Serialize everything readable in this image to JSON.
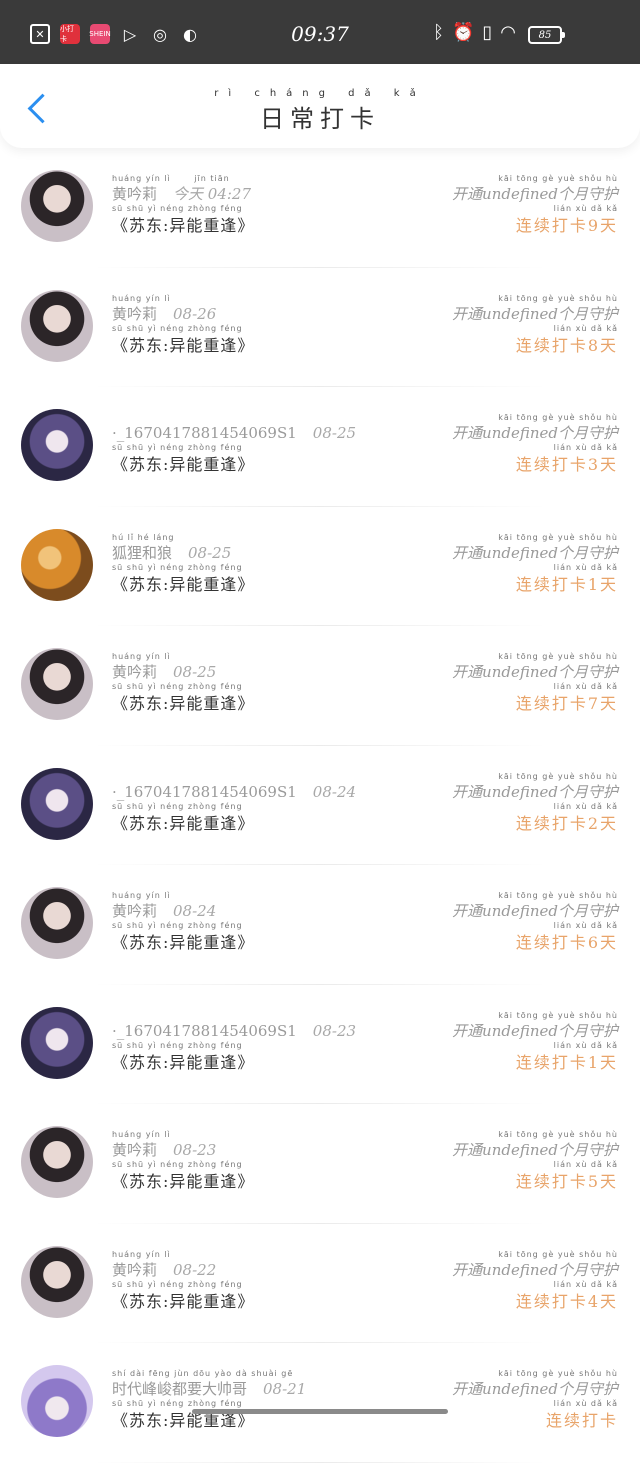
{
  "status_bar": {
    "time": "09:37",
    "battery": "85",
    "left_icons": [
      "x-box-icon",
      "app-red-icon",
      "app-pink-icon",
      "play-icon",
      "weibo-icon",
      "compass-icon"
    ],
    "right_icons": [
      "bluetooth-icon",
      "alarm-icon",
      "vibrate-icon",
      "wifi-icon",
      "battery-icon"
    ],
    "app_red_label": "小打卡",
    "app_pink_label": "SHEIN"
  },
  "header": {
    "title_pinyin": "rì cháng dǎ kǎ",
    "title": "日常打卡"
  },
  "colors": {
    "accent_blue": "#2b8ff0",
    "streak_orange": "#e8a46a"
  },
  "list": [
    {
      "name_pinyin": "huáng yín lì",
      "name": "黄吟莉",
      "date_pinyin": "jīn tiān",
      "date": "今天 04:27",
      "book_pinyin": "sū shū yì néng zhòng féng",
      "book": "《苏东:异能重逢》",
      "status_pinyin": "kāi tōng gè yuè shǒu hù",
      "status": "开通undefined个月守护",
      "streak_pinyin": "lián xù dǎ kǎ",
      "streak": "连续打卡9天",
      "avatar": "a"
    },
    {
      "name_pinyin": "huáng yín lì",
      "name": "黄吟莉",
      "date_pinyin": "",
      "date": "08-26",
      "book_pinyin": "sū shū yì néng zhòng féng",
      "book": "《苏东:异能重逢》",
      "status_pinyin": "kāi tōng gè yuè shǒu hù",
      "status": "开通undefined个月守护",
      "streak_pinyin": "lián xù dǎ kǎ",
      "streak": "连续打卡8天",
      "avatar": "a"
    },
    {
      "name_pinyin": "",
      "name": "·_1670417881454069S1",
      "date_pinyin": "",
      "date": "08-25",
      "book_pinyin": "sū shū yì néng zhòng féng",
      "book": "《苏东:异能重逢》",
      "status_pinyin": "kāi tōng gè yuè shǒu hù",
      "status": "开通undefined个月守护",
      "streak_pinyin": "lián xù dǎ kǎ",
      "streak": "连续打卡3天",
      "avatar": "b"
    },
    {
      "name_pinyin": "hú lǐ hé láng",
      "name": "狐狸和狼",
      "date_pinyin": "",
      "date": "08-25",
      "book_pinyin": "sū shū yì néng zhòng féng",
      "book": "《苏东:异能重逢》",
      "status_pinyin": "kāi tōng gè yuè shǒu hù",
      "status": "开通undefined个月守护",
      "streak_pinyin": "lián xù dǎ kǎ",
      "streak": "连续打卡1天",
      "avatar": "c"
    },
    {
      "name_pinyin": "huáng yín lì",
      "name": "黄吟莉",
      "date_pinyin": "",
      "date": "08-25",
      "book_pinyin": "sū shū yì néng zhòng féng",
      "book": "《苏东:异能重逢》",
      "status_pinyin": "kāi tōng gè yuè shǒu hù",
      "status": "开通undefined个月守护",
      "streak_pinyin": "lián xù dǎ kǎ",
      "streak": "连续打卡7天",
      "avatar": "a"
    },
    {
      "name_pinyin": "",
      "name": "·_1670417881454069S1",
      "date_pinyin": "",
      "date": "08-24",
      "book_pinyin": "sū shū yì néng zhòng féng",
      "book": "《苏东:异能重逢》",
      "status_pinyin": "kāi tōng gè yuè shǒu hù",
      "status": "开通undefined个月守护",
      "streak_pinyin": "lián xù dǎ kǎ",
      "streak": "连续打卡2天",
      "avatar": "b"
    },
    {
      "name_pinyin": "huáng yín lì",
      "name": "黄吟莉",
      "date_pinyin": "",
      "date": "08-24",
      "book_pinyin": "sū shū yì néng zhòng féng",
      "book": "《苏东:异能重逢》",
      "status_pinyin": "kāi tōng gè yuè shǒu hù",
      "status": "开通undefined个月守护",
      "streak_pinyin": "lián xù dǎ kǎ",
      "streak": "连续打卡6天",
      "avatar": "a"
    },
    {
      "name_pinyin": "",
      "name": "·_1670417881454069S1",
      "date_pinyin": "",
      "date": "08-23",
      "book_pinyin": "sū shū yì néng zhòng féng",
      "book": "《苏东:异能重逢》",
      "status_pinyin": "kāi tōng gè yuè shǒu hù",
      "status": "开通undefined个月守护",
      "streak_pinyin": "lián xù dǎ kǎ",
      "streak": "连续打卡1天",
      "avatar": "b"
    },
    {
      "name_pinyin": "huáng yín lì",
      "name": "黄吟莉",
      "date_pinyin": "",
      "date": "08-23",
      "book_pinyin": "sū shū yì néng zhòng féng",
      "book": "《苏东:异能重逢》",
      "status_pinyin": "kāi tōng gè yuè shǒu hù",
      "status": "开通undefined个月守护",
      "streak_pinyin": "lián xù dǎ kǎ",
      "streak": "连续打卡5天",
      "avatar": "a"
    },
    {
      "name_pinyin": "huáng yín lì",
      "name": "黄吟莉",
      "date_pinyin": "",
      "date": "08-22",
      "book_pinyin": "sū shū yì néng zhòng féng",
      "book": "《苏东:异能重逢》",
      "status_pinyin": "kāi tōng gè yuè shǒu hù",
      "status": "开通undefined个月守护",
      "streak_pinyin": "lián xù dǎ kǎ",
      "streak": "连续打卡4天",
      "avatar": "a"
    },
    {
      "name_pinyin": "shí dài fēng jùn dōu yào dà shuài gē",
      "name": "时代峰峻都要大帅哥",
      "date_pinyin": "",
      "date": "08-21",
      "book_pinyin": "sū shū yì néng zhòng féng",
      "book": "《苏东:异能重逢》",
      "status_pinyin": "kāi tōng gè yuè shǒu hù",
      "status": "开通undefined个月守护",
      "streak_pinyin": "lián xù dǎ kǎ",
      "streak": "连续打卡",
      "avatar": "d"
    }
  ]
}
